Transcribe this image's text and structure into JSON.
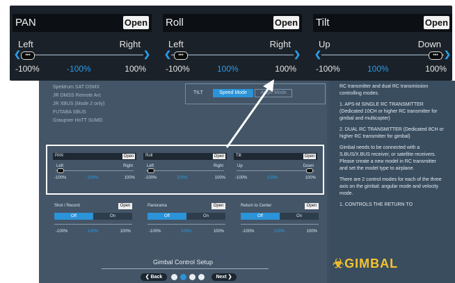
{
  "top_panel": {
    "axes": [
      {
        "title": "PAN",
        "open": "Open",
        "left": "Left",
        "right": "Right",
        "min": "-100%",
        "cur": "-100%",
        "max": "100%",
        "thumb": "•••"
      },
      {
        "title": "Roll",
        "open": "Open",
        "left": "Left",
        "right": "Right",
        "min": "-100%",
        "cur": "100%",
        "max": "100%",
        "thumb": "•••"
      },
      {
        "title": "Tilt",
        "open": "Open",
        "left": "Up",
        "right": "Down",
        "min": "-100%",
        "cur": "100%",
        "max": "100%",
        "thumb": "•••"
      }
    ]
  },
  "app": {
    "rc_list": [
      "Spektrum SAT DSMX",
      "JR DMSS Remote Arc",
      "JR XBUS (Mode 2 only)",
      "FUTABA SBUS",
      "Graupner HoTT SUMD"
    ],
    "tilt": {
      "label": "TILT",
      "speed_mode": "Speed Mode",
      "angle_mode": "Angle Mode"
    },
    "mini_axes": [
      {
        "title": "PAN",
        "open": "Open",
        "left": "Left",
        "right": "Right",
        "min": "-100%",
        "cur": "-100%",
        "max": "100%"
      },
      {
        "title": "Roll",
        "open": "Open",
        "left": "Left",
        "right": "Right",
        "min": "-100%",
        "cur": "100%",
        "max": "100%"
      },
      {
        "title": "Tilt",
        "open": "Open",
        "left": "Up",
        "right": "Down",
        "min": "-100%",
        "cur": "100%",
        "max": "100%"
      }
    ],
    "toggles": [
      {
        "title": "Shot / Record",
        "open": "Open",
        "off": "Off",
        "on": "On",
        "min": "-100%",
        "cur": "100%",
        "max": "100%"
      },
      {
        "title": "Panorama",
        "open": "Open",
        "off": "Off",
        "on": "On",
        "min": "-100%",
        "cur": "100%",
        "max": "100%"
      },
      {
        "title": "Return to Center",
        "open": "Open",
        "off": "Off",
        "on": "On",
        "min": "-100%",
        "cur": "100%",
        "max": "100%"
      }
    ],
    "footer_title": "Gimbal Control Setup",
    "back": "Back",
    "next": "Next",
    "side_text": [
      "RC transmitter and dual RC transmission controlling modes.",
      "1. APS-M SINGLE RC TRANSMITTER (Dedicated 10CH or higher RC transmitter for gimbal and multicopter)",
      "2. DUAL RC TRANSMITTER (Dedicated 8CH or higher RC transmitter for gimbal)",
      "Gimbal needs to be connected with a S.BUS/X.BUS receiver, or satellite receivers. Please create a new model in RC transmitter and set the model type to airplane.",
      "There are 2 control modes for each of the three axis on the gimbal: angular mode and velocity mode.",
      "1. CONTROLS THE RETURN TO"
    ],
    "logo": "GIMBAL"
  },
  "colors": {
    "accent": "#2b93d8",
    "panel": "#1b2128",
    "app_bg": "#435567",
    "logo": "#f6c32e"
  }
}
